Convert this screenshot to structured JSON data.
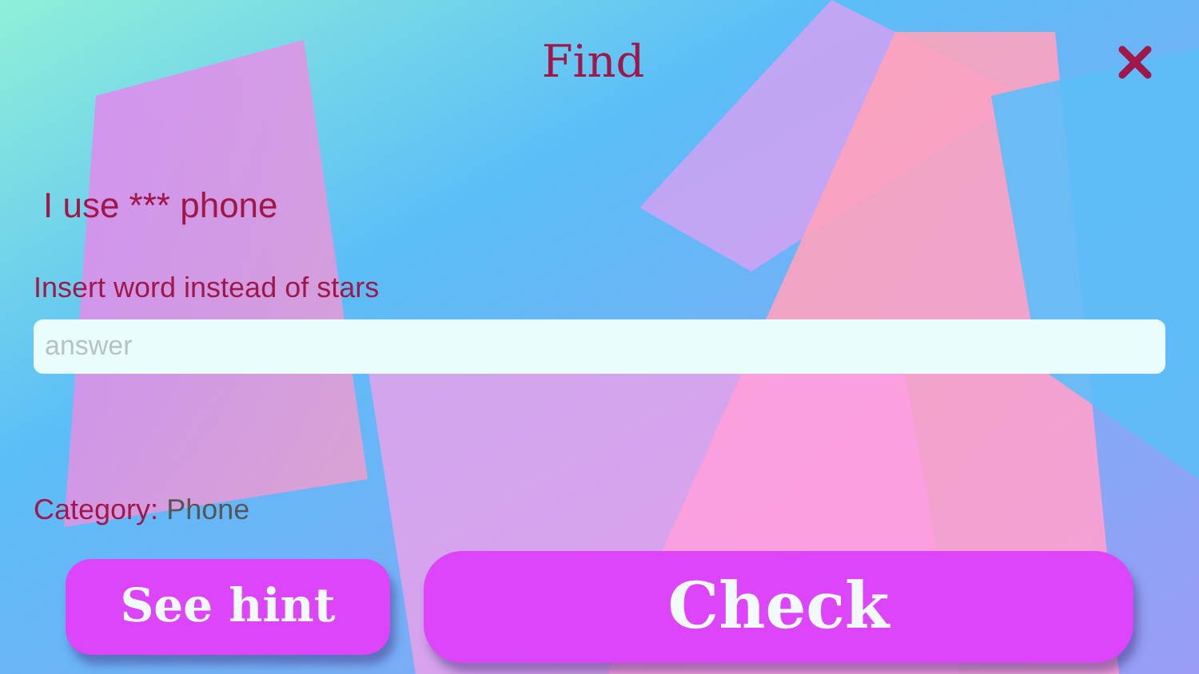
{
  "header": {
    "title": "Find"
  },
  "question": "I use *** phone",
  "answer": {
    "label": "Insert word instead of stars",
    "placeholder": "answer"
  },
  "category": {
    "label": "Category:",
    "value": "Phone"
  },
  "buttons": [
    {
      "kind": "hint",
      "label": "See hint"
    },
    {
      "kind": "check",
      "label": "Check"
    }
  ]
}
